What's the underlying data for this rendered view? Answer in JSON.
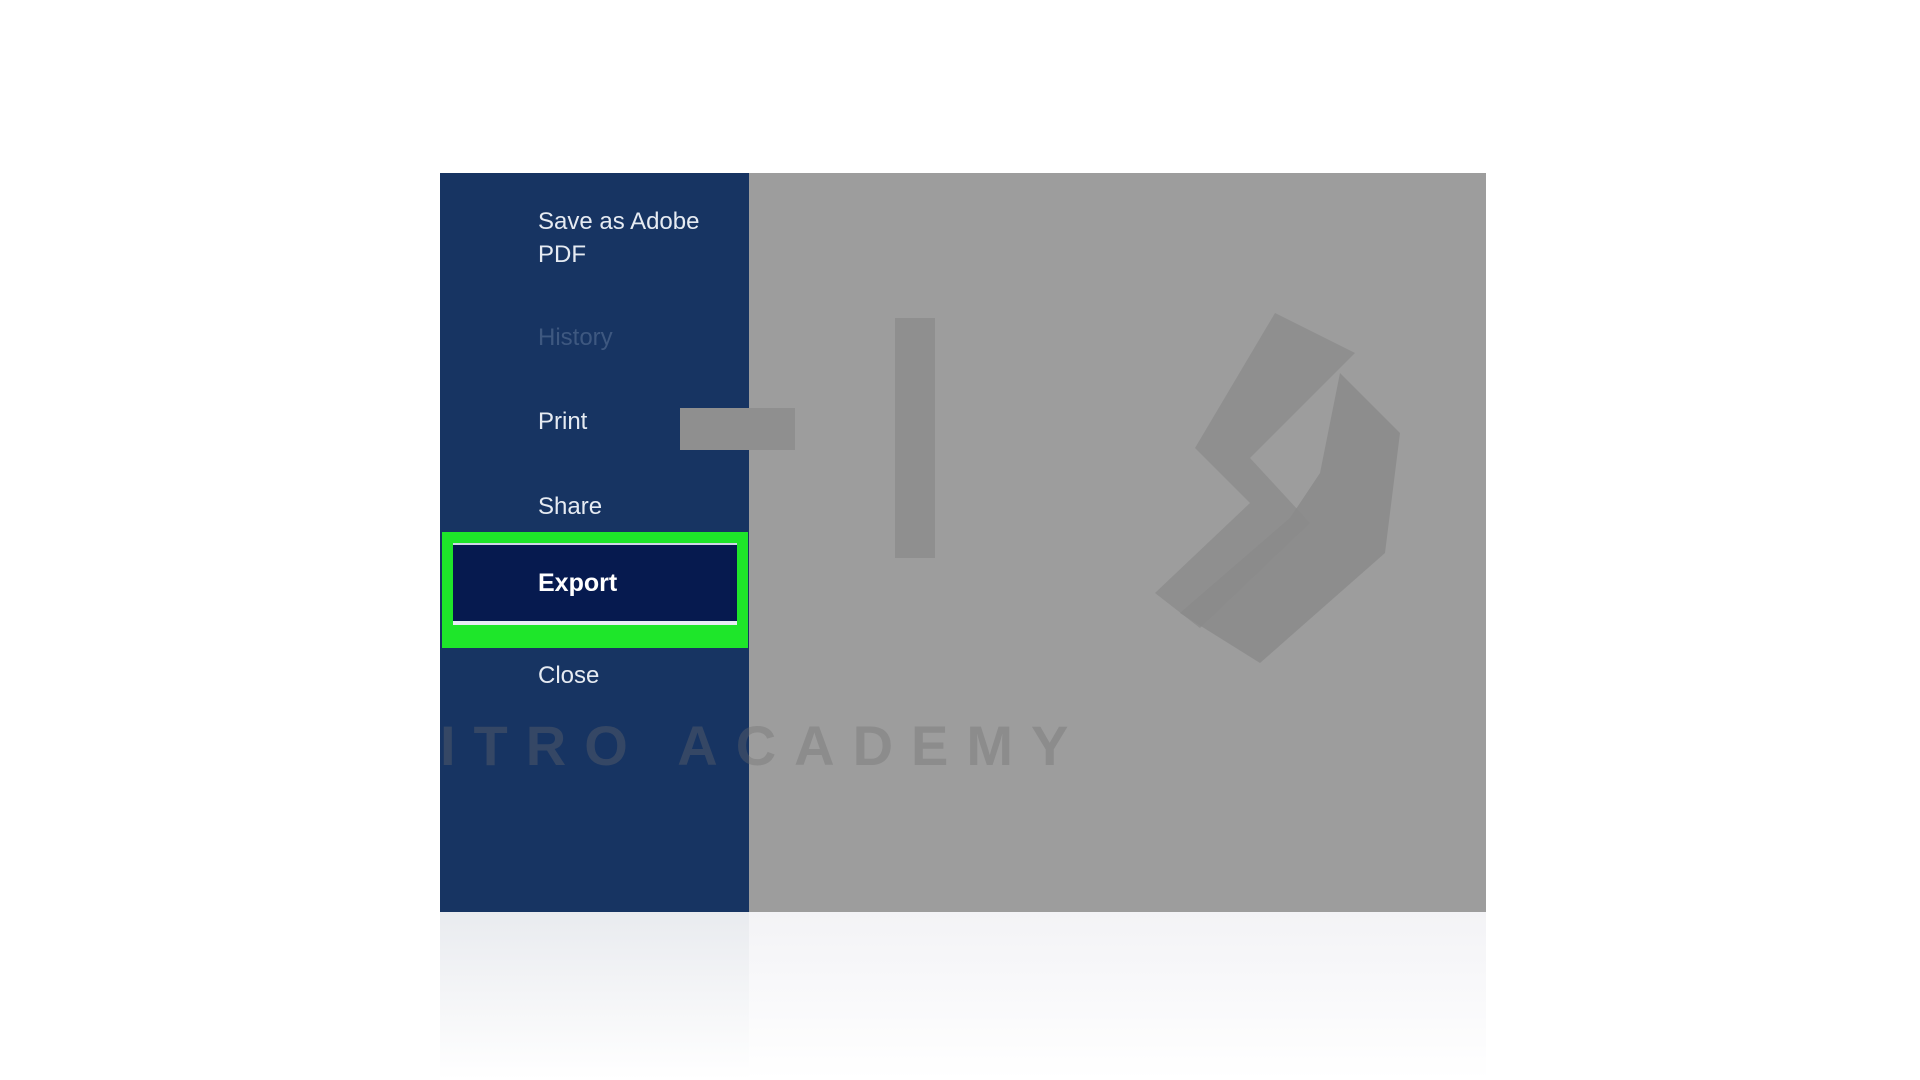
{
  "menu": {
    "save_as_pdf_line1": "Save as Adobe",
    "save_as_pdf_line2": "PDF",
    "history": "History",
    "print": "Print",
    "share": "Share",
    "export": "Export",
    "close": "Close"
  },
  "watermark": {
    "text": "ITRO ACADEMY"
  },
  "colors": {
    "sidebar": "#173462",
    "selected_item": "#061a4f",
    "highlight": "#1ee62a",
    "preview_area": "#9d9d9d"
  }
}
